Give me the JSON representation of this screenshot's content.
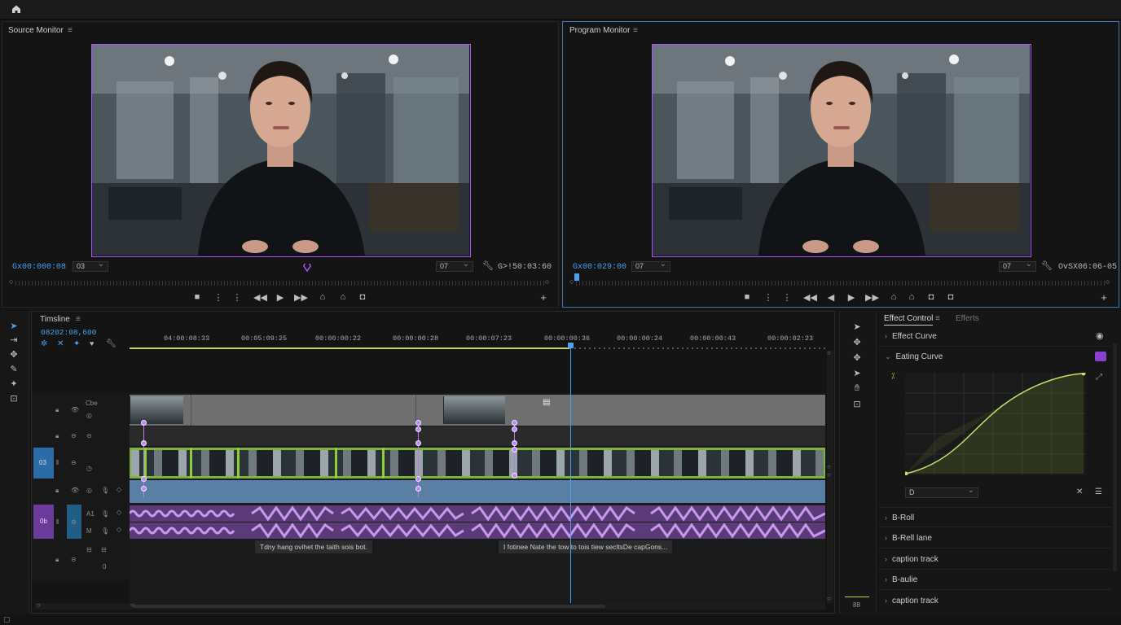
{
  "source_monitor": {
    "title": "Source Monitor",
    "timecode_in": "Gx00:000:08",
    "zoom": "03",
    "quality": "07",
    "timecode_out": "G>!50:03:60"
  },
  "program_monitor": {
    "title": "Program Monitor",
    "timecode_in": "Gx00:029:00",
    "zoom": "07",
    "quality": "07",
    "timecode_out": "OvSX06:06-05"
  },
  "timeline": {
    "title": "Timsline",
    "timecode": "08202:08,600",
    "ruler": [
      "04:00:08:33",
      "00:05:09:25",
      "00:00:00:22",
      "00:00:00:28",
      "00:00:07:23",
      "00:00:00:36",
      "00:00:00:24",
      "00:00:00:43",
      "00:00:02:23"
    ],
    "track_labels": {
      "v1": "Cbe",
      "v3": "03",
      "a1": "0b",
      "a_label1": "A1",
      "a_label2": "M"
    },
    "captions": [
      "Tdny hang ovihet the taith sois bot.",
      "I fotinee Nate the tow to tois tiew secltsDe capGons..."
    ],
    "scroll_label": "88"
  },
  "effects": {
    "tabs": [
      "Effect Control",
      "Efferts"
    ],
    "rows_top": [
      "Effect Curve",
      "Eating Curve"
    ],
    "curve_dropdown": "D",
    "rows_bottom": [
      "B-Roll",
      "B-Rell lane",
      "caption track",
      "B-aulie",
      "caption track"
    ]
  },
  "colors": {
    "accent_purple": "#a855f7",
    "accent_blue": "#4aa3f0",
    "clip_green": "#84cc16",
    "audio_purple": "#9b6dc9"
  },
  "icons": [
    "home-icon",
    "selection-tool-icon",
    "track-select-icon",
    "ripple-icon",
    "razor-icon",
    "slip-icon",
    "pen-icon",
    "hand-icon",
    "zoom-icon",
    "play-icon",
    "step-back-icon",
    "step-forward-icon",
    "stop-icon",
    "lift-icon",
    "extract-icon",
    "export-frame-icon",
    "plus-icon",
    "wrench-icon",
    "lock-icon",
    "eye-icon",
    "mic-icon",
    "keyframe-icon"
  ]
}
